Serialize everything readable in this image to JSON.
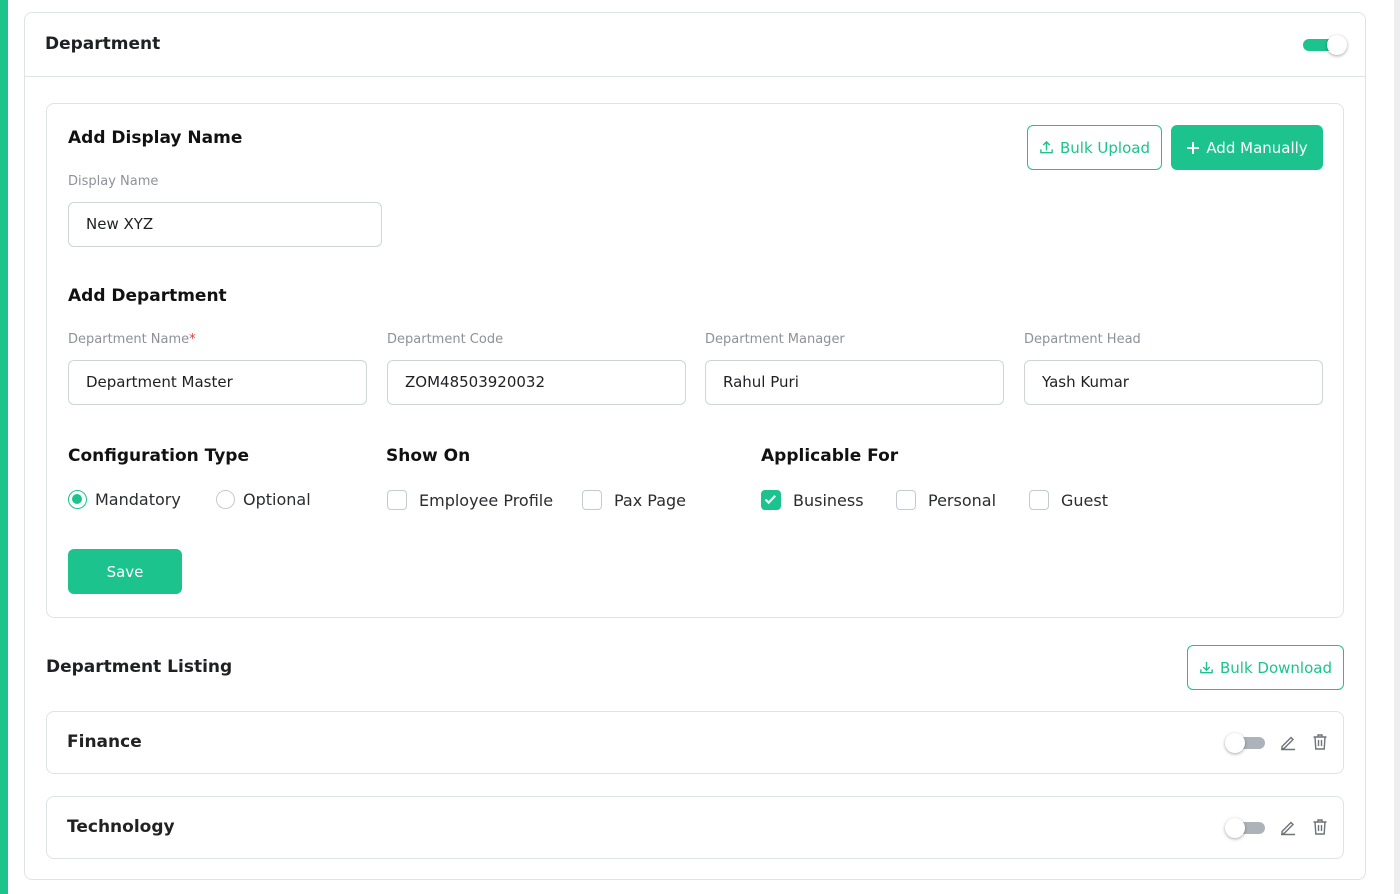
{
  "department_section": {
    "title": "Department",
    "enabled": true
  },
  "display_name_section": {
    "title": "Add Display Name",
    "field_label": "Display Name",
    "field_value": "New XYZ",
    "bulk_upload_label": "Bulk Upload",
    "add_manually_label": "Add Manually"
  },
  "add_department": {
    "title": "Add Department",
    "fields": [
      {
        "label": "Department Name",
        "required_mark": "*",
        "value": "Department Master"
      },
      {
        "label": "Department Code",
        "value": "ZOM48503920032"
      },
      {
        "label": "Department Manager",
        "value": "Rahul Puri"
      },
      {
        "label": "Department Head",
        "value": "Yash Kumar"
      }
    ]
  },
  "configuration_type": {
    "title": "Configuration Type",
    "options": [
      {
        "label": "Mandatory",
        "selected": true
      },
      {
        "label": "Optional",
        "selected": false
      }
    ]
  },
  "show_on": {
    "title": "Show On",
    "options": [
      {
        "label": "Employee Profile",
        "checked": false
      },
      {
        "label": "Pax Page",
        "checked": false
      }
    ]
  },
  "applicable_for": {
    "title": "Applicable For",
    "options": [
      {
        "label": "Business",
        "checked": true
      },
      {
        "label": "Personal",
        "checked": false
      },
      {
        "label": "Guest",
        "checked": false
      }
    ]
  },
  "save_label": "Save",
  "listing": {
    "title": "Department Listing",
    "bulk_download_label": "Bulk Download",
    "items": [
      {
        "name": "Finance",
        "enabled": false
      },
      {
        "name": "Technology",
        "enabled": false
      }
    ]
  },
  "colors": {
    "accent": "#1cc38d",
    "border": "#dfe3e6",
    "muted_text": "#8d9199"
  },
  "icons": {
    "upload": "upload-icon",
    "plus": "plus-icon",
    "download": "download-icon",
    "edit": "pencil-icon",
    "delete": "trash-icon"
  }
}
